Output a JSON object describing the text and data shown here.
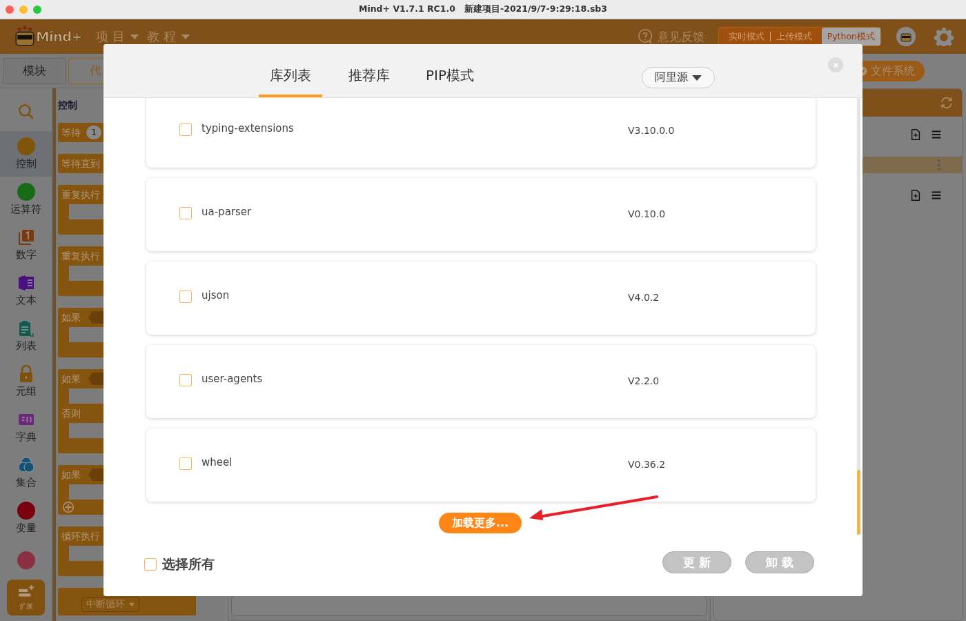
{
  "window": {
    "title": "Mind+ V1.7.1 RC1.0   新建项目-2021/9/7-9:29:18.sb3"
  },
  "header": {
    "logo": "Mind+",
    "menus": [
      "项 目",
      "教 程"
    ],
    "feedback": "意见反馈",
    "modes": [
      {
        "label": "实时模式",
        "selected": false
      },
      {
        "label": "上传模式",
        "selected": false
      },
      {
        "label": "Python模式",
        "selected": true
      }
    ]
  },
  "editor_tabs": [
    {
      "label": "模块",
      "selected": false
    },
    {
      "label": "代",
      "selected": true
    }
  ],
  "categories": [
    {
      "kind": "search",
      "selected": false
    },
    {
      "kind": "dot",
      "label": "控制",
      "color": "#7f550c",
      "selected": true
    },
    {
      "kind": "dot",
      "label": "运算符",
      "color": "#176b17",
      "selected": false
    },
    {
      "kind": "number",
      "label": "数字",
      "selected": false
    },
    {
      "kind": "text",
      "label": "文本",
      "selected": false
    },
    {
      "kind": "list",
      "label": "列表",
      "selected": false
    },
    {
      "kind": "tuple",
      "label": "元组",
      "selected": false
    },
    {
      "kind": "dict",
      "label": "字典",
      "selected": false
    },
    {
      "kind": "set",
      "label": "集合",
      "selected": false
    },
    {
      "kind": "dot",
      "label": "变量",
      "color": "#7a0010",
      "selected": false
    },
    {
      "kind": "dot",
      "color": "#8a3040",
      "selected": false
    }
  ],
  "extension": "扩展",
  "palette": {
    "title": "控制",
    "blocks": [
      {
        "kind": "value",
        "label": "等待",
        "value": "1"
      },
      {
        "kind": "stack",
        "label": "等待直到"
      },
      {
        "kind": "c",
        "label": "重复执行"
      },
      {
        "kind": "c",
        "label": "重复执行"
      },
      {
        "kind": "if",
        "label": "如果"
      },
      {
        "kind": "ifelse",
        "label": "如果",
        "else": "否则"
      },
      {
        "kind": "ifplus",
        "label": "如果"
      },
      {
        "kind": "c",
        "label": "循环执行"
      },
      {
        "kind": "dropdown",
        "label": "中断循环"
      }
    ]
  },
  "file_panel": {
    "button": "文件系统"
  },
  "library_dialog": {
    "tabs": [
      {
        "label": "库列表",
        "selected": true
      },
      {
        "label": "推荐库",
        "selected": false
      },
      {
        "label": "PIP模式",
        "selected": false
      }
    ],
    "source": "阿里源",
    "packages": [
      {
        "name": "typing-extensions",
        "version": "V3.10.0.0",
        "checked": false
      },
      {
        "name": "ua-parser",
        "version": "V0.10.0",
        "checked": false
      },
      {
        "name": "ujson",
        "version": "V4.0.2",
        "checked": false
      },
      {
        "name": "user-agents",
        "version": "V2.2.0",
        "checked": false
      },
      {
        "name": "wheel",
        "version": "V0.36.2",
        "checked": false
      }
    ],
    "load_more": "加载更多...",
    "select_all": {
      "label": "选择所有",
      "checked": false
    },
    "buttons": [
      {
        "label": "更 新",
        "disabled": true
      },
      {
        "label": "卸 载",
        "disabled": true
      }
    ]
  }
}
